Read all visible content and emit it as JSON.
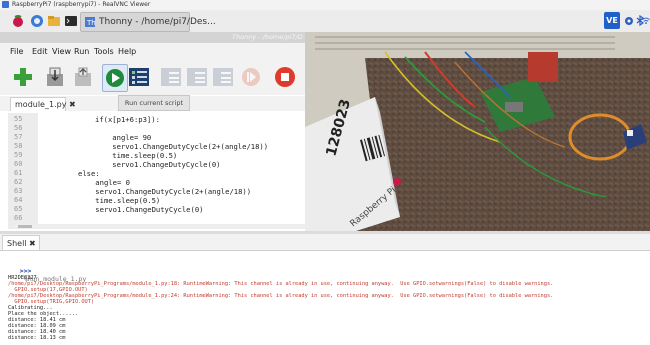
{
  "vnc": {
    "title": "RaspberryPi7 (raspberrypi7) - RealVNC Viewer"
  },
  "taskbar": {
    "window_button": "Thonny - /home/pi7/Des...",
    "tray_label": "VE"
  },
  "thonny": {
    "window_title": "Thonny - /home/pi7/D",
    "menu": [
      "File",
      "Edit",
      "View",
      "Run",
      "Tools",
      "Help"
    ],
    "tooltip": "Run current script",
    "tab": "module_1.py ✖",
    "line_numbers": [
      "55",
      "56",
      "57",
      "58",
      "59",
      "60",
      "61",
      "62",
      "63",
      "64",
      "65",
      "66"
    ],
    "code": [
      "if(x[p1+6:p3]):",
      "",
      "    angle= 90",
      "    servo1.ChangeDutyCycle(2+(angle/18))",
      "    time.sleep(0.5)",
      "    servo1.ChangeDutyCycle(0)",
      "else:",
      "    angle= 0",
      "    servo1.ChangeDutyCycle(2+(angle/18))",
      "    time.sleep(0.5)",
      "    servo1.ChangeDutyCycle(0)",
      ""
    ]
  },
  "shell": {
    "tab": "Shell ✖",
    "prompt": ">>>",
    "command": "%Run module_1.py",
    "lines": [
      {
        "text": "HR2DE8327",
        "style": "dark"
      },
      {
        "text": "/home/pi7/Desktop/RaspberryPi_Programs/module_1.py:18: RuntimeWarning: This channel is already in use, continuing anyway.  Use GPIO.setwarnings(False) to disable warnings.",
        "style": "red"
      },
      {
        "text": "  GPIO.setup(17,GPIO.OUT)",
        "style": "red"
      },
      {
        "text": "/home/pi7/Desktop/RaspberryPi_Programs/module_1.py:24: RuntimeWarning: This channel is already in use, continuing anyway.  Use GPIO.setwarnings(False) to disable warnings.",
        "style": "red"
      },
      {
        "text": "  GPIO.setup(TRIG,GPIO.OUT)",
        "style": "red"
      },
      {
        "text": "Calibrating...",
        "style": "dark"
      },
      {
        "text": "Place the object......",
        "style": "dark"
      },
      {
        "text": "distance: 18.41 cm",
        "style": "dark"
      },
      {
        "text": "distance: 18.09 cm",
        "style": "dark"
      },
      {
        "text": "distance: 18.40 cm",
        "style": "dark"
      },
      {
        "text": "distance: 18.13 cm",
        "style": "dark"
      }
    ]
  },
  "camera": {
    "barcode_text": "128023",
    "box_text": "Raspberry Pi"
  },
  "colors": {
    "run_button": "#1f8a3a",
    "stop_button": "#e03a2a",
    "warning_text": "#c0392b",
    "prompt": "#1a3fa6"
  }
}
